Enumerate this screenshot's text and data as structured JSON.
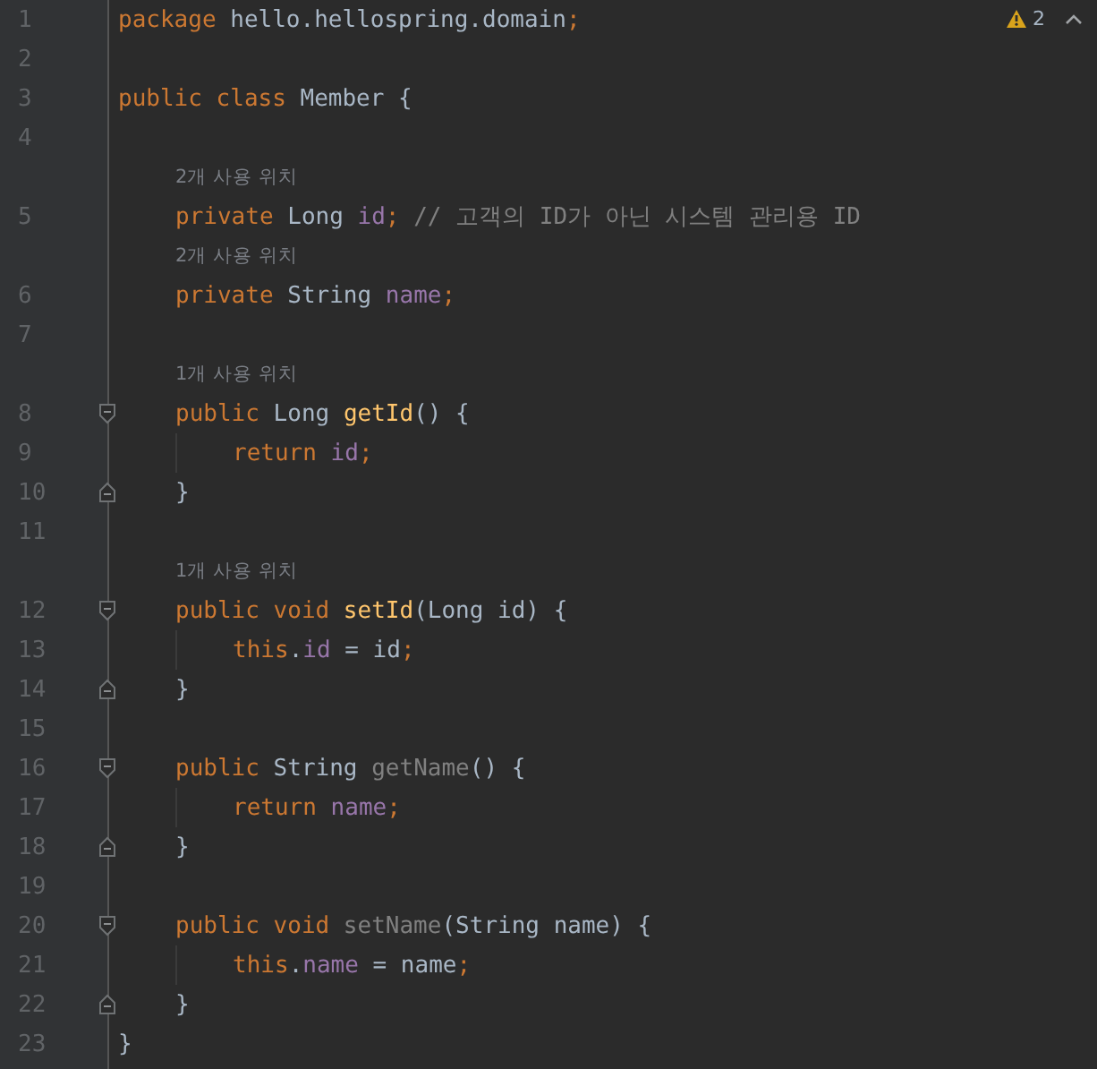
{
  "inspection_widget": {
    "warnings": "2"
  },
  "lines": [
    {
      "number": "1",
      "tokens": [
        {
          "kind": "keyword",
          "text": "package"
        },
        {
          "kind": "plain",
          "text": " hello.hellospring.domain"
        },
        {
          "kind": "keyword",
          "text": ";"
        }
      ]
    },
    {
      "number": "2"
    },
    {
      "number": "3",
      "tokens": [
        {
          "kind": "keyword",
          "text": "public class"
        },
        {
          "kind": "plain",
          "text": " Member {"
        }
      ],
      "children": [
        {
          "number": "4"
        },
        {
          "number": "5",
          "hint": "2개 사용 위치",
          "tokens": [
            {
              "kind": "keyword",
              "text": "private"
            },
            {
              "kind": "plain",
              "text": " Long "
            },
            {
              "kind": "field",
              "text": "id"
            },
            {
              "kind": "keyword",
              "text": ";"
            },
            {
              "kind": "comment",
              "text": " // 고객의 ID가 아닌 시스템 관리용 ID"
            }
          ]
        },
        {
          "number": "6",
          "hint": "2개 사용 위치",
          "tokens": [
            {
              "kind": "keyword",
              "text": "private"
            },
            {
              "kind": "plain",
              "text": " String "
            },
            {
              "kind": "field",
              "text": "name"
            },
            {
              "kind": "keyword",
              "text": ";"
            }
          ]
        },
        {
          "number": "7"
        },
        {
          "number": "8",
          "hint": "1개 사용 위치",
          "fold_start": true,
          "tokens": [
            {
              "kind": "keyword",
              "text": "public"
            },
            {
              "kind": "plain",
              "text": " Long "
            },
            {
              "kind": "method",
              "text": "getId"
            },
            {
              "kind": "plain",
              "text": "() {"
            }
          ],
          "children": [
            {
              "number": "9",
              "tokens": [
                {
                  "kind": "keyword",
                  "text": "return"
                },
                {
                  "kind": "field",
                  "text": " id"
                },
                {
                  "kind": "keyword",
                  "text": ";"
                }
              ]
            }
          ]
        },
        {
          "number": "10",
          "fold_end": true,
          "tokens": [
            {
              "kind": "plain",
              "text": "}"
            }
          ]
        },
        {
          "number": "11"
        },
        {
          "number": "12",
          "hint": "1개 사용 위치",
          "fold_start": true,
          "tokens": [
            {
              "kind": "keyword",
              "text": "public void"
            },
            {
              "kind": "method",
              "text": " setId"
            },
            {
              "kind": "plain",
              "text": "(Long id) {"
            }
          ],
          "children": [
            {
              "number": "13",
              "tokens": [
                {
                  "kind": "keyword",
                  "text": "this"
                },
                {
                  "kind": "plain",
                  "text": "."
                },
                {
                  "kind": "field",
                  "text": "id"
                },
                {
                  "kind": "plain",
                  "text": " = id"
                },
                {
                  "kind": "keyword",
                  "text": ";"
                }
              ]
            }
          ]
        },
        {
          "number": "14",
          "fold_end": true,
          "tokens": [
            {
              "kind": "plain",
              "text": "}"
            }
          ]
        },
        {
          "number": "15"
        },
        {
          "number": "16",
          "fold_start": true,
          "tokens": [
            {
              "kind": "keyword",
              "text": "public"
            },
            {
              "kind": "plain",
              "text": " String "
            },
            {
              "kind": "unused",
              "text": "getName"
            },
            {
              "kind": "plain",
              "text": "() {"
            }
          ],
          "children": [
            {
              "number": "17",
              "tokens": [
                {
                  "kind": "keyword",
                  "text": "return"
                },
                {
                  "kind": "field",
                  "text": " name"
                },
                {
                  "kind": "keyword",
                  "text": ";"
                }
              ]
            }
          ]
        },
        {
          "number": "18",
          "fold_end": true,
          "tokens": [
            {
              "kind": "plain",
              "text": "}"
            }
          ]
        },
        {
          "number": "19"
        },
        {
          "number": "20",
          "fold_start": true,
          "tokens": [
            {
              "kind": "keyword",
              "text": "public void"
            },
            {
              "kind": "unused",
              "text": " setName"
            },
            {
              "kind": "plain",
              "text": "(String name) {"
            }
          ],
          "children": [
            {
              "number": "21",
              "tokens": [
                {
                  "kind": "keyword",
                  "text": "this"
                },
                {
                  "kind": "plain",
                  "text": "."
                },
                {
                  "kind": "field",
                  "text": "name"
                },
                {
                  "kind": "plain",
                  "text": " = name"
                },
                {
                  "kind": "keyword",
                  "text": ";"
                }
              ]
            }
          ]
        },
        {
          "number": "22",
          "fold_end": true,
          "tokens": [
            {
              "kind": "plain",
              "text": "}"
            }
          ]
        }
      ]
    },
    {
      "number": "23",
      "tokens": [
        {
          "kind": "plain",
          "text": "}"
        }
      ]
    }
  ]
}
